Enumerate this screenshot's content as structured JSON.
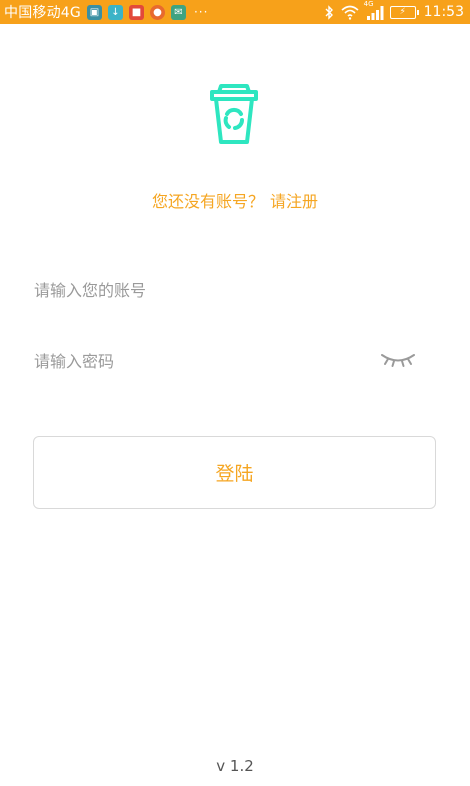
{
  "status_bar": {
    "carrier": "中国移动4G",
    "more": "···",
    "time": "11:53",
    "network_type": "4G",
    "icons": [
      "bluetooth-icon",
      "wifi-icon",
      "signal-icon",
      "battery-charging-icon"
    ]
  },
  "register": {
    "prompt": "您还没有账号？",
    "link": "请注册"
  },
  "form": {
    "account_placeholder": "请输入您的账号",
    "account_value": "",
    "password_placeholder": "请输入密码",
    "password_value": "",
    "login_label": "登陆"
  },
  "version": "v 1.2",
  "colors": {
    "status_bar": "#f7a11a",
    "accent": "#f5a623",
    "logo": "#2ee6c0",
    "placeholder": "#9a9a9a",
    "button_border": "#d9d9d9"
  }
}
